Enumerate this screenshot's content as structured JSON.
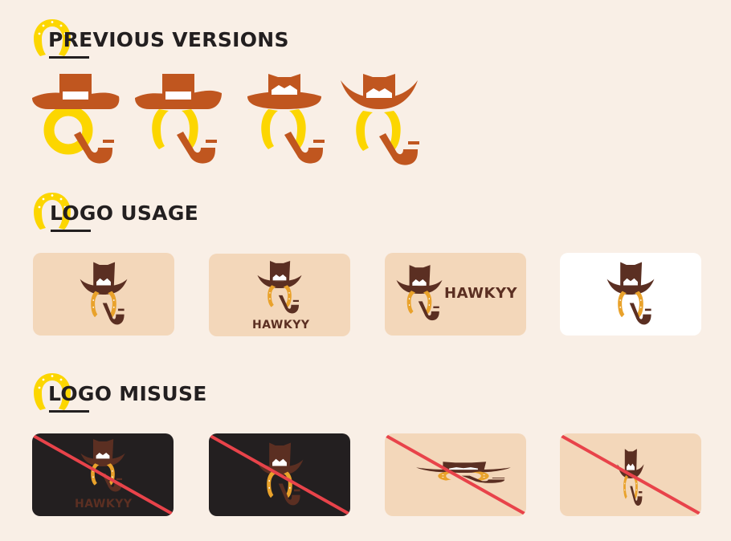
{
  "sections": {
    "previous_versions": {
      "title": "PREVIOUS VERSIONS"
    },
    "logo_usage": {
      "title": "LOGO USAGE"
    },
    "logo_misuse": {
      "title": "LOGO MISUSE"
    }
  },
  "brand": {
    "wordmark": "HAWKYY"
  },
  "usage_cards": [
    {
      "layout": "mark-only",
      "background": "#f3d7ba"
    },
    {
      "layout": "stacked-wordmark",
      "wordmark": "HAWKYY",
      "background": "#f3d7ba"
    },
    {
      "layout": "horizontal-wordmark",
      "wordmark": "HAWKYY",
      "background": "#f3d7ba"
    },
    {
      "layout": "mark-only",
      "background": "#ffffff"
    }
  ],
  "misuse_cards": [
    {
      "issue": "low-contrast-dark-background",
      "wordmark": "HAWKYY",
      "background": "#231f20"
    },
    {
      "issue": "dark-background",
      "background": "#231f20"
    },
    {
      "issue": "squashed",
      "background": "#f3d7ba"
    },
    {
      "issue": "stretched",
      "background": "#f3d7ba"
    }
  ],
  "colors": {
    "page_bg": "#f9efe6",
    "rust": "#c0561f",
    "brown": "#5b2f22",
    "gold": "#e9a22b",
    "yellow": "#fcd600",
    "dark": "#231f20",
    "strike": "#e8434a"
  }
}
